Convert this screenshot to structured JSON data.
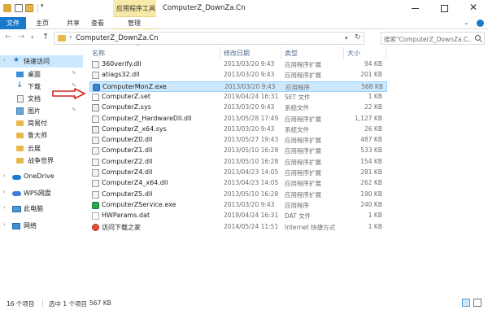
{
  "window": {
    "context_tab": "应用程序工具",
    "title": "ComputerZ_DownZa.Cn",
    "minimize_label": "",
    "close_glyph": "✕"
  },
  "ribbon": {
    "tabs": {
      "file": "文件",
      "home": "主页",
      "share": "共享",
      "view": "查看",
      "manage": "管理"
    }
  },
  "address": {
    "path": "ComputerZ_DownZa.Cn",
    "search_placeholder": "搜索\"ComputerZ_DownZa.C...\""
  },
  "sidebar": {
    "items": [
      {
        "label": "快速访问",
        "icon": "star-icon"
      },
      {
        "label": "桌面",
        "icon": "desktop-icon"
      },
      {
        "label": "下载",
        "icon": "download-icon"
      },
      {
        "label": "文档",
        "icon": "document-icon"
      },
      {
        "label": "图片",
        "icon": "picture-icon"
      },
      {
        "label": "简易付",
        "icon": "folder-icon"
      },
      {
        "label": "鲁大师",
        "icon": "folder-icon"
      },
      {
        "label": "云展",
        "icon": "folder-icon"
      },
      {
        "label": "战争世界",
        "icon": "folder-icon"
      },
      {
        "label": "OneDrive",
        "icon": "cloud-icon"
      },
      {
        "label": "WPS网盘",
        "icon": "cloud-icon"
      },
      {
        "label": "此电脑",
        "icon": "computer-icon"
      },
      {
        "label": "网络",
        "icon": "network-icon"
      }
    ]
  },
  "columns": {
    "name": "名称",
    "date": "修改日期",
    "type": "类型",
    "size": "大小"
  },
  "files": [
    {
      "name": "360verify.dll",
      "date": "2013/03/20 9:43",
      "type": "应用程序扩展",
      "size": "94 KB",
      "kind": "dll"
    },
    {
      "name": "atiags32.dll",
      "date": "2013/03/20 9:43",
      "type": "应用程序扩展",
      "size": "201 KB",
      "kind": "dll"
    },
    {
      "name": "ComputerMonZ.exe",
      "date": "2013/03/20 9:43",
      "type": "应用程序",
      "size": "568 KB",
      "kind": "exe"
    },
    {
      "name": "ComputerZ.set",
      "date": "2019/04/24 16:31",
      "type": "SET 文件",
      "size": "1 KB",
      "kind": "set"
    },
    {
      "name": "ComputerZ.sys",
      "date": "2013/03/20 9:43",
      "type": "系统文件",
      "size": "22 KB",
      "kind": "sys"
    },
    {
      "name": "ComputerZ_HardwareDll.dll",
      "date": "2013/05/28 17:49",
      "type": "应用程序扩展",
      "size": "1,127 KB",
      "kind": "dll"
    },
    {
      "name": "ComputerZ_x64.sys",
      "date": "2013/03/20 9:43",
      "type": "系统文件",
      "size": "26 KB",
      "kind": "sys"
    },
    {
      "name": "ComputerZ0.dll",
      "date": "2013/05/27 19:43",
      "type": "应用程序扩展",
      "size": "487 KB",
      "kind": "dll"
    },
    {
      "name": "ComputerZ1.dll",
      "date": "2013/05/10 16:28",
      "type": "应用程序扩展",
      "size": "533 KB",
      "kind": "dll"
    },
    {
      "name": "ComputerZ2.dll",
      "date": "2013/05/10 16:28",
      "type": "应用程序扩展",
      "size": "154 KB",
      "kind": "dll"
    },
    {
      "name": "ComputerZ4.dll",
      "date": "2013/04/23 14:05",
      "type": "应用程序扩展",
      "size": "281 KB",
      "kind": "dll"
    },
    {
      "name": "ComputerZ4_x64.dll",
      "date": "2013/04/23 14:05",
      "type": "应用程序扩展",
      "size": "262 KB",
      "kind": "dll"
    },
    {
      "name": "ComputerZ5.dll",
      "date": "2013/05/10 16:28",
      "type": "应用程序扩展",
      "size": "190 KB",
      "kind": "dll"
    },
    {
      "name": "ComputerZService.exe",
      "date": "2013/03/20 9:43",
      "type": "应用程序",
      "size": "240 KB",
      "kind": "svc"
    },
    {
      "name": "HWParams.dat",
      "date": "2019/04/24 16:31",
      "type": "DAT 文件",
      "size": "1 KB",
      "kind": "dat"
    },
    {
      "name": "访问下载之家",
      "date": "2014/05/24 11:51",
      "type": "Internet 快捷方式",
      "size": "1 KB",
      "kind": "url"
    }
  ],
  "selected_index": 2,
  "status": {
    "count": "16 个项目",
    "selected": "选中 1 个项目",
    "size": "567 KB"
  },
  "colors": {
    "accent": "#1979ca",
    "selection": "#cce8ff",
    "context_tab": "#f7e9a8",
    "arrow": "#d8231b"
  }
}
